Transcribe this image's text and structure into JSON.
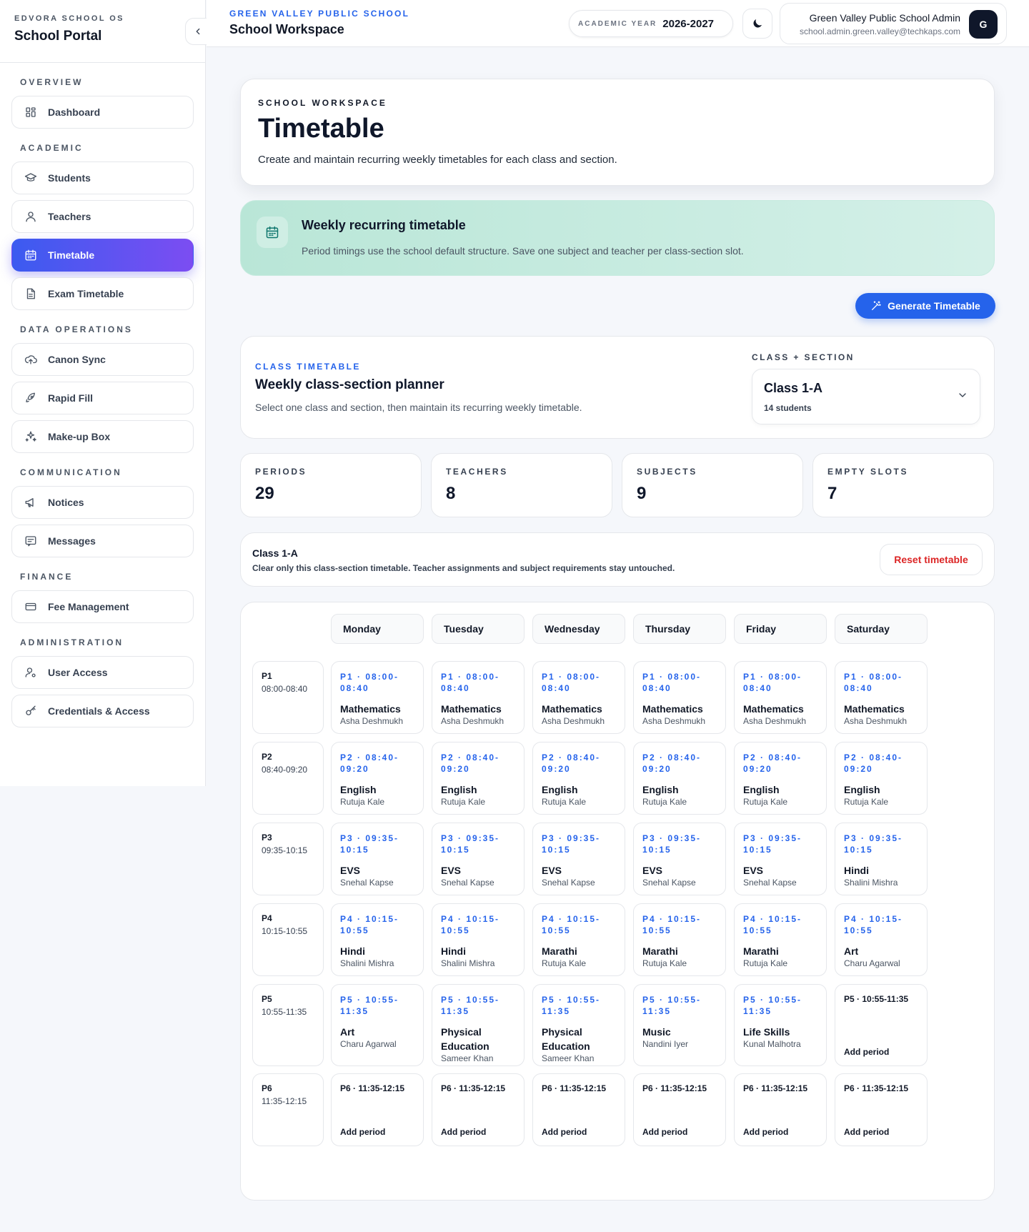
{
  "sidebar": {
    "kicker": "EDVORA SCHOOL OS",
    "title": "School Portal",
    "sections": [
      {
        "title": "OVERVIEW",
        "items": [
          {
            "label": "Dashboard",
            "icon": "dashboard-icon"
          }
        ]
      },
      {
        "title": "ACADEMIC",
        "items": [
          {
            "label": "Students",
            "icon": "graduation-cap-icon"
          },
          {
            "label": "Teachers",
            "icon": "user-icon"
          },
          {
            "label": "Timetable",
            "icon": "calendar-icon",
            "active": true
          },
          {
            "label": "Exam Timetable",
            "icon": "document-icon"
          }
        ]
      },
      {
        "title": "DATA OPERATIONS",
        "items": [
          {
            "label": "Canon Sync",
            "icon": "cloud-upload-icon"
          },
          {
            "label": "Rapid Fill",
            "icon": "rocket-icon"
          },
          {
            "label": "Make-up Box",
            "icon": "sparkles-icon"
          }
        ]
      },
      {
        "title": "COMMUNICATION",
        "items": [
          {
            "label": "Notices",
            "icon": "megaphone-icon"
          },
          {
            "label": "Messages",
            "icon": "message-icon"
          }
        ]
      },
      {
        "title": "FINANCE",
        "items": [
          {
            "label": "Fee Management",
            "icon": "credit-card-icon"
          }
        ]
      },
      {
        "title": "ADMINISTRATION",
        "items": [
          {
            "label": "User Access",
            "icon": "user-gear-icon"
          },
          {
            "label": "Credentials & Access",
            "icon": "key-icon"
          }
        ]
      }
    ]
  },
  "topbar": {
    "school": "GREEN VALLEY PUBLIC SCHOOL",
    "title": "School Workspace",
    "academic_year_label": "ACADEMIC YEAR",
    "academic_year_value": "2026-2027",
    "user_name": "Green Valley Public School Admin",
    "user_email": "school.admin.green.valley@techkaps.com",
    "avatar_initial": "G"
  },
  "hero": {
    "kicker": "SCHOOL WORKSPACE",
    "title": "Timetable",
    "description": "Create and maintain recurring weekly timetables for each class and section."
  },
  "banner": {
    "title": "Weekly recurring timetable",
    "description": "Period timings use the school default structure. Save one subject and teacher per class-section slot."
  },
  "generate_button": "Generate Timetable",
  "planner": {
    "kicker": "CLASS TIMETABLE",
    "title": "Weekly class-section planner",
    "description": "Select one class and section, then maintain its recurring weekly timetable.",
    "select_label": "CLASS + SECTION",
    "select_value": "Class 1-A",
    "select_sub": "14 students"
  },
  "stats": [
    {
      "label": "PERIODS",
      "value": "29"
    },
    {
      "label": "TEACHERS",
      "value": "8"
    },
    {
      "label": "SUBJECTS",
      "value": "9"
    },
    {
      "label": "EMPTY SLOTS",
      "value": "7"
    }
  ],
  "reset": {
    "title": "Class 1-A",
    "description": "Clear only this class-section timetable. Teacher assignments and subject requirements stay untouched.",
    "button": "Reset timetable"
  },
  "timetable": {
    "days": [
      "Monday",
      "Tuesday",
      "Wednesday",
      "Thursday",
      "Friday",
      "Saturday"
    ],
    "add_label": "Add period",
    "periods": [
      {
        "code": "P1",
        "time": "08:00-08:40",
        "slots": [
          {
            "head": "P1 · 08:00-08:40",
            "subject": "Mathematics",
            "teacher": "Asha Deshmukh"
          },
          {
            "head": "P1 · 08:00-08:40",
            "subject": "Mathematics",
            "teacher": "Asha Deshmukh"
          },
          {
            "head": "P1 · 08:00-08:40",
            "subject": "Mathematics",
            "teacher": "Asha Deshmukh"
          },
          {
            "head": "P1 · 08:00-08:40",
            "subject": "Mathematics",
            "teacher": "Asha Deshmukh"
          },
          {
            "head": "P1 · 08:00-08:40",
            "subject": "Mathematics",
            "teacher": "Asha Deshmukh"
          },
          {
            "head": "P1 · 08:00-08:40",
            "subject": "Mathematics",
            "teacher": "Asha Deshmukh"
          }
        ]
      },
      {
        "code": "P2",
        "time": "08:40-09:20",
        "slots": [
          {
            "head": "P2 · 08:40-09:20",
            "subject": "English",
            "teacher": "Rutuja Kale"
          },
          {
            "head": "P2 · 08:40-09:20",
            "subject": "English",
            "teacher": "Rutuja Kale"
          },
          {
            "head": "P2 · 08:40-09:20",
            "subject": "English",
            "teacher": "Rutuja Kale"
          },
          {
            "head": "P2 · 08:40-09:20",
            "subject": "English",
            "teacher": "Rutuja Kale"
          },
          {
            "head": "P2 · 08:40-09:20",
            "subject": "English",
            "teacher": "Rutuja Kale"
          },
          {
            "head": "P2 · 08:40-09:20",
            "subject": "English",
            "teacher": "Rutuja Kale"
          }
        ]
      },
      {
        "code": "P3",
        "time": "09:35-10:15",
        "slots": [
          {
            "head": "P3 · 09:35-10:15",
            "subject": "EVS",
            "teacher": "Snehal Kapse"
          },
          {
            "head": "P3 · 09:35-10:15",
            "subject": "EVS",
            "teacher": "Snehal Kapse"
          },
          {
            "head": "P3 · 09:35-10:15",
            "subject": "EVS",
            "teacher": "Snehal Kapse"
          },
          {
            "head": "P3 · 09:35-10:15",
            "subject": "EVS",
            "teacher": "Snehal Kapse"
          },
          {
            "head": "P3 · 09:35-10:15",
            "subject": "EVS",
            "teacher": "Snehal Kapse"
          },
          {
            "head": "P3 · 09:35-10:15",
            "subject": "Hindi",
            "teacher": "Shalini Mishra"
          }
        ]
      },
      {
        "code": "P4",
        "time": "10:15-10:55",
        "slots": [
          {
            "head": "P4 · 10:15-10:55",
            "subject": "Hindi",
            "teacher": "Shalini Mishra"
          },
          {
            "head": "P4 · 10:15-10:55",
            "subject": "Hindi",
            "teacher": "Shalini Mishra"
          },
          {
            "head": "P4 · 10:15-10:55",
            "subject": "Marathi",
            "teacher": "Rutuja Kale"
          },
          {
            "head": "P4 · 10:15-10:55",
            "subject": "Marathi",
            "teacher": "Rutuja Kale"
          },
          {
            "head": "P4 · 10:15-10:55",
            "subject": "Marathi",
            "teacher": "Rutuja Kale"
          },
          {
            "head": "P4 · 10:15-10:55",
            "subject": "Art",
            "teacher": "Charu Agarwal"
          }
        ]
      },
      {
        "code": "P5",
        "time": "10:55-11:35",
        "slots": [
          {
            "head": "P5 · 10:55-11:35",
            "subject": "Art",
            "teacher": "Charu Agarwal"
          },
          {
            "head": "P5 · 10:55-11:35",
            "subject": "Physical Education",
            "teacher": "Sameer Khan"
          },
          {
            "head": "P5 · 10:55-11:35",
            "subject": "Physical Education",
            "teacher": "Sameer Khan"
          },
          {
            "head": "P5 · 10:55-11:35",
            "subject": "Music",
            "teacher": "Nandini Iyer"
          },
          {
            "head": "P5 · 10:55-11:35",
            "subject": "Life Skills",
            "teacher": "Kunal Malhotra"
          },
          {
            "head": "P5 · 10:55-11:35",
            "empty": true
          }
        ]
      },
      {
        "code": "P6",
        "time": "11:35-12:15",
        "slots": [
          {
            "head": "P6 · 11:35-12:15",
            "empty": true
          },
          {
            "head": "P6 · 11:35-12:15",
            "empty": true
          },
          {
            "head": "P6 · 11:35-12:15",
            "empty": true
          },
          {
            "head": "P6 · 11:35-12:15",
            "empty": true
          },
          {
            "head": "P6 · 11:35-12:15",
            "empty": true
          },
          {
            "head": "P6 · 11:35-12:15",
            "empty": true
          }
        ]
      }
    ]
  },
  "colors": {
    "accent": "#2563eb",
    "active_gradient_start": "#3b5bf0",
    "active_gradient_end": "#7c4df2",
    "danger": "#dc2626",
    "banner": "#b9e6d7"
  }
}
